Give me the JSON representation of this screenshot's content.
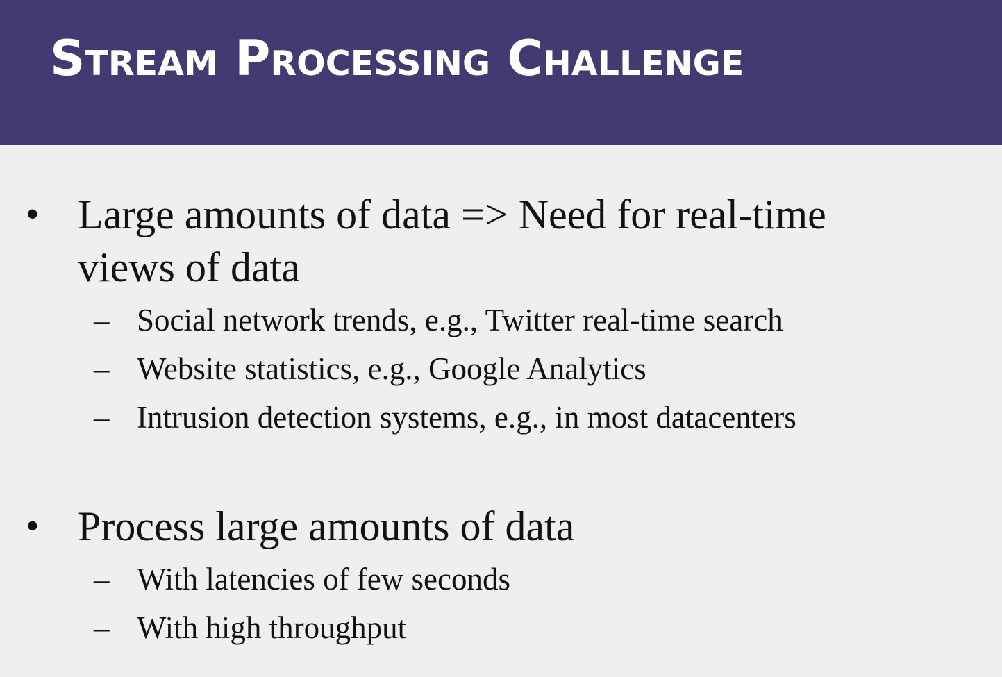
{
  "slide": {
    "title": "Stream Processing Challenge",
    "bullets": [
      {
        "marker": "•",
        "text": "Large amounts of data => Need for real-time views of data",
        "subitems": [
          {
            "marker": "–",
            "text": "Social network trends, e.g., Twitter real-time search"
          },
          {
            "marker": "–",
            "text": "Website statistics, e.g., Google Analytics"
          },
          {
            "marker": "–",
            "text": "Intrusion detection systems, e.g., in most datacenters"
          }
        ]
      },
      {
        "marker": "•",
        "text": "Process large amounts of data",
        "subitems": [
          {
            "marker": "–",
            "text": "With latencies of few seconds"
          },
          {
            "marker": "–",
            "text": "With high throughput"
          }
        ]
      }
    ]
  },
  "colors": {
    "header_background": "#433a71",
    "title_text": "#ffffff",
    "body_background": "#efefef",
    "body_text": "#111111"
  }
}
